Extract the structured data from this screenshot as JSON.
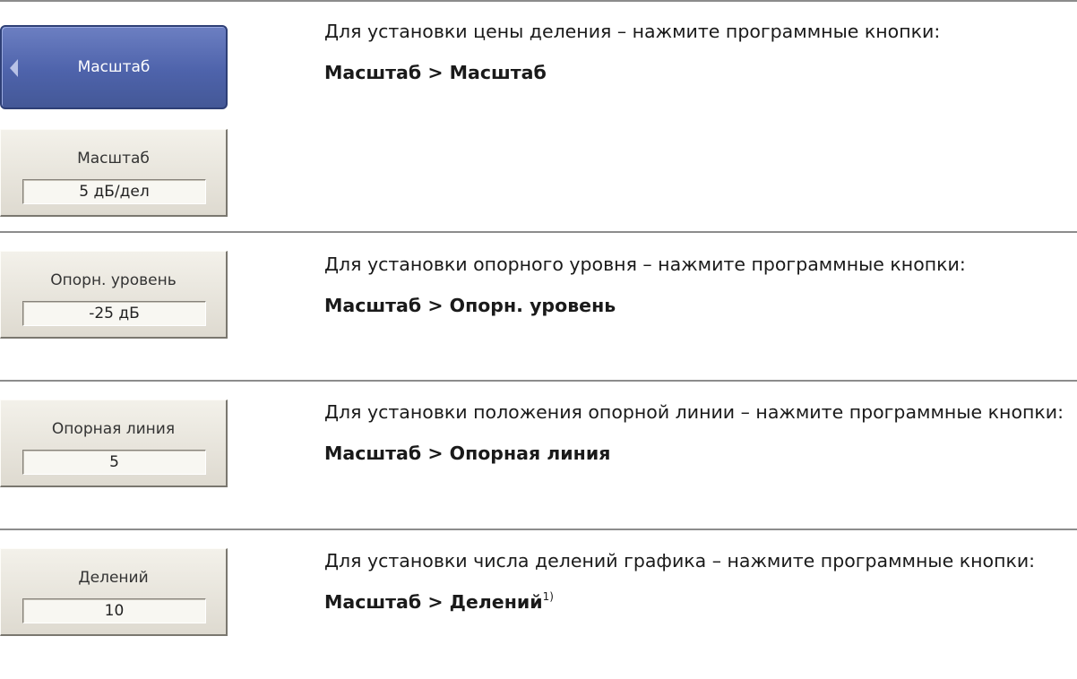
{
  "rows": [
    {
      "submenu_label": "Масштаб",
      "softkey_label": "Масштаб",
      "softkey_value": "5 дБ/дел",
      "description": "Для установки цены деления – нажмите программные кнопки:",
      "path": "Масштаб > Масштаб"
    },
    {
      "softkey_label": "Опорн. уровень",
      "softkey_value": "-25 дБ",
      "description": "Для установки опорного уровня – нажмите программные кнопки:",
      "path": "Масштаб > Опорн. уровень"
    },
    {
      "softkey_label": "Опорная линия",
      "softkey_value": "5",
      "description": "Для установки положения опорной линии – нажмите программные кнопки:",
      "path": "Масштаб > Опорная линия"
    },
    {
      "softkey_label": "Делений",
      "softkey_value": "10",
      "description": "Для установки числа делений графика – нажмите программные кнопки:",
      "path": "Масштаб > Делений",
      "footnote_mark": "1)"
    }
  ]
}
